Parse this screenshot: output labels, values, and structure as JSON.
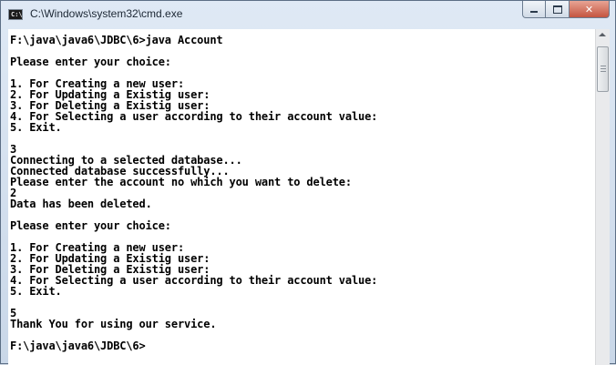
{
  "window": {
    "title": "C:\\Windows\\system32\\cmd.exe",
    "icon": "cmd-icon",
    "icon_text": "C:\\"
  },
  "controls": {
    "minimize": "minimize-icon",
    "maximize": "maximize-icon",
    "close_label": "✕"
  },
  "console": {
    "text": "F:\\java\\java6\\JDBC\\6>java Account\n\nPlease enter your choice:\n\n1. For Creating a new user:\n2. For Updating a Existig user:\n3. For Deleting a Existig user:\n4. For Selecting a user according to their account value:\n5. Exit.\n\n3\nConnecting to a selected database...\nConnected database successfully...\nPlease enter the account no which you want to delete:\n2\nData has been deleted.\n\nPlease enter your choice:\n\n1. For Creating a new user:\n2. For Updating a Existig user:\n3. For Deleting a Existig user:\n4. For Selecting a user according to their account value:\n5. Exit.\n\n5\nThank You for using our service.\n\nF:\\java\\java6\\JDBC\\6>"
  },
  "colors": {
    "console_background": "#ffffff",
    "console_text": "#000000",
    "close_button": "#c45540"
  }
}
